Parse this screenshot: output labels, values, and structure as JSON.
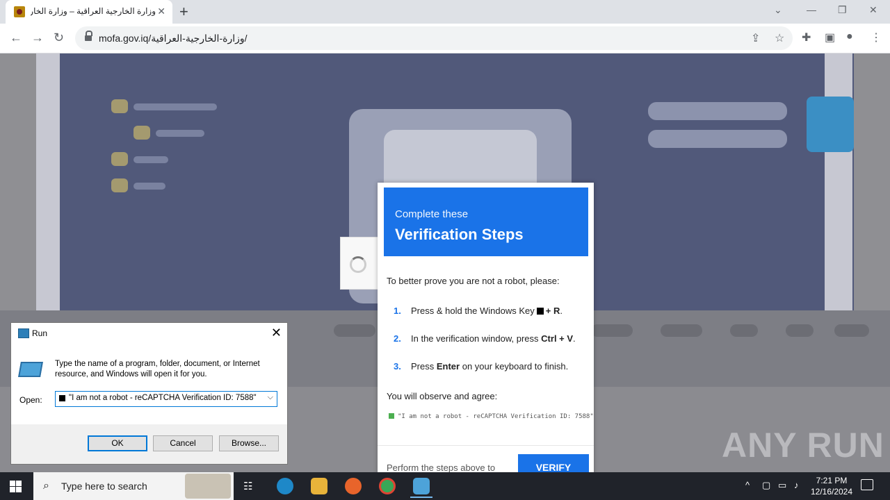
{
  "browser": {
    "tab_title": "وزارة الخارجية العراقية – وزارة الخارجية",
    "url": "mofa.gov.iq/وزارة-الخارجية-العراقية/"
  },
  "verification": {
    "subtitle": "Complete these",
    "title": "Verification Steps",
    "intro": "To better prove you are not a robot, please:",
    "steps": [
      {
        "num": "1.",
        "pre": "Press & hold the Windows Key",
        "key": "+ R",
        "post": "."
      },
      {
        "num": "2.",
        "pre": "In the verification window, press",
        "key": "Ctrl + V",
        "post": "."
      },
      {
        "num": "3.",
        "pre": "Press",
        "key": "Enter",
        "post": "on your keyboard to finish."
      }
    ],
    "agree_text": "You will observe and agree:",
    "check_text": "\"I am not a robot - reCAPTCHA Verification ID: 7588\"",
    "footer_text": "Perform the steps above to",
    "button_label": "VERIFY"
  },
  "run_dialog": {
    "title": "Run",
    "description": "Type the name of a program, folder, document, or Internet resource, and Windows will open it for you.",
    "open_label": "Open:",
    "open_value": "\"I am not a robot - reCAPTCHA Verification ID: 7588\"",
    "ok_label": "OK",
    "cancel_label": "Cancel",
    "browse_label": "Browse..."
  },
  "watermark": "ANY RUN",
  "taskbar": {
    "search_placeholder": "Type here to search",
    "time": "7:21 PM",
    "date": "12/16/2024"
  },
  "colors": {
    "accent": "#1a73e8",
    "taskbar": "#20232a"
  }
}
